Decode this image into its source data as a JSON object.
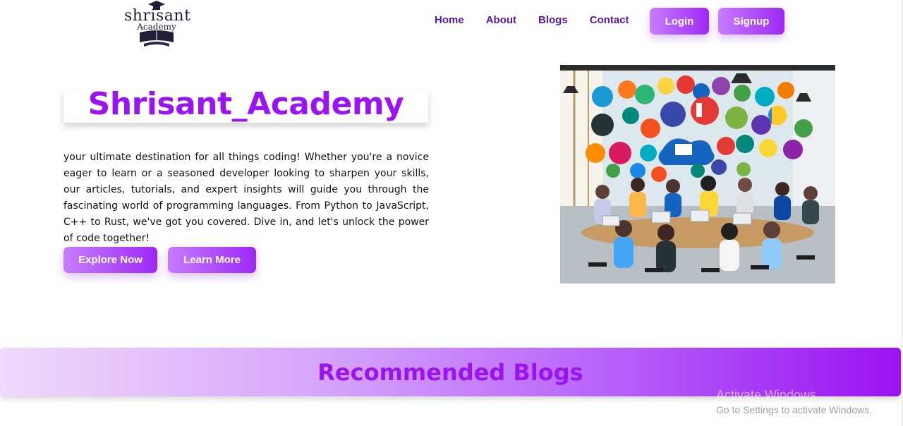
{
  "logo": {
    "line1": "shrisant",
    "line2": "Academy"
  },
  "nav": [
    {
      "label": "Home"
    },
    {
      "label": "About"
    },
    {
      "label": "Blogs"
    },
    {
      "label": "Contact"
    }
  ],
  "auth": {
    "login": "Login",
    "signup": "Signup"
  },
  "hero": {
    "title": "Shrisant_Academy",
    "description": "your ultimate destination for all things coding! Whether you're a novice eager to learn or a seasoned developer looking to sharpen your skills, our articles, tutorials, and expert insights will guide you through the fascinating world of programming languages. From Python to JavaScript, C++ to Rust, we've got you covered. Dive in, and let's unlock the power of code together!",
    "explore_label": "Explore Now",
    "learn_label": "Learn More"
  },
  "recommended": {
    "title": "Recommended Blogs"
  },
  "watermark": {
    "line1": "Activate Windows",
    "line2": "Go to Settings to activate Windows."
  },
  "colors": {
    "accent": "#9a13f2",
    "nav": "#5b16a6",
    "button_start": "#c77dff",
    "button_end": "#9d28f5"
  }
}
